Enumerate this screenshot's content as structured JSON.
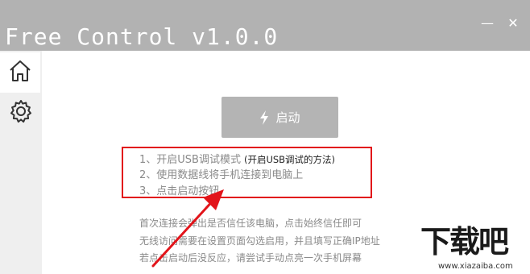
{
  "window": {
    "title": "Free Control v1.0.0",
    "minimize_label": "—",
    "close_label": "✕"
  },
  "sidebar": {
    "items": [
      {
        "name": "home",
        "icon": "home-icon"
      },
      {
        "name": "settings",
        "icon": "gear-icon"
      }
    ]
  },
  "main": {
    "start_button_label": "启动",
    "steps": [
      {
        "text": "1、开启USB调试模式",
        "link": "(开启USB调试的方法)"
      },
      {
        "text": "2、使用数据线将手机连接到电脑上"
      },
      {
        "text": "3、点击启动按钮"
      }
    ],
    "notes": [
      "首次连接会弹出是否信任该电脑，点击始终信任即可",
      "无线访问需要在设置页面勾选启用，并且填写正确IP地址",
      "若点击启动后没反应，请尝试手动点亮一次手机屏幕"
    ]
  },
  "watermark": {
    "text": "下载吧",
    "url": "www.xiazaiba.com"
  },
  "colors": {
    "titlebar": "#b2b2b2",
    "sidebar": "#efefef",
    "button": "#b4b4b4",
    "highlight_border": "#e2141a",
    "annotation_arrow": "#e2141a"
  }
}
